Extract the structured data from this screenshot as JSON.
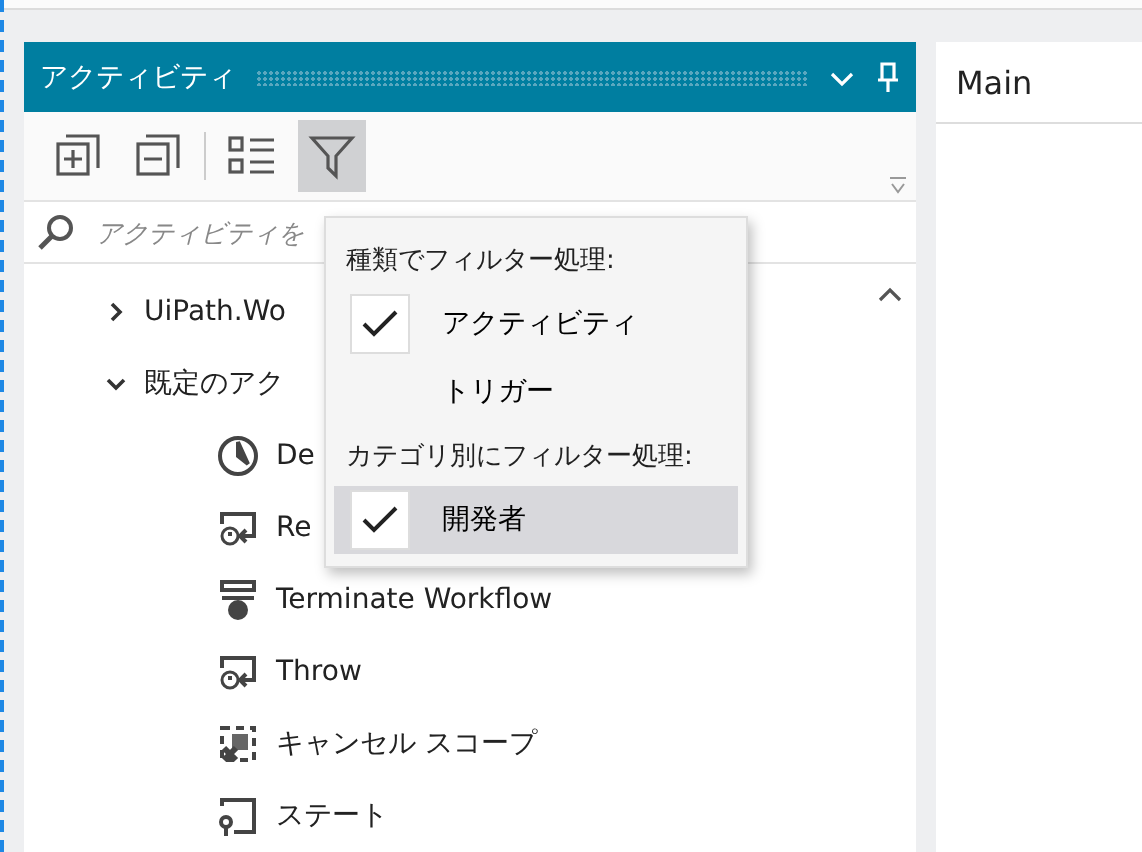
{
  "panel": {
    "title": "アクティビティ",
    "search": {
      "placeholder": "アクティビティを"
    },
    "tree": [
      {
        "label": "UiPath.Wo",
        "expanded": false
      },
      {
        "label": "既定のアク",
        "expanded": true,
        "children": [
          {
            "label": "De",
            "kind": "clock"
          },
          {
            "label": "Re",
            "kind": "rethrow"
          },
          {
            "label": "Terminate Workflow",
            "kind": "terminate"
          },
          {
            "label": "Throw",
            "kind": "rethrow"
          },
          {
            "label": "キャンセル スコープ",
            "kind": "cancel"
          },
          {
            "label": "ステート",
            "kind": "state"
          }
        ]
      }
    ]
  },
  "filter_menu": {
    "open": true,
    "items": [
      {
        "kind": "header",
        "label": "種類でフィルター処理:"
      },
      {
        "kind": "option",
        "label": "アクティビティ",
        "checked": true,
        "selected": false
      },
      {
        "kind": "option",
        "label": "トリガー",
        "checked": false,
        "selected": false
      },
      {
        "kind": "header",
        "label": "カテゴリ別にフィルター処理:"
      },
      {
        "kind": "option",
        "label": "開発者",
        "checked": true,
        "selected": true
      }
    ]
  },
  "document": {
    "tab": "Main"
  }
}
